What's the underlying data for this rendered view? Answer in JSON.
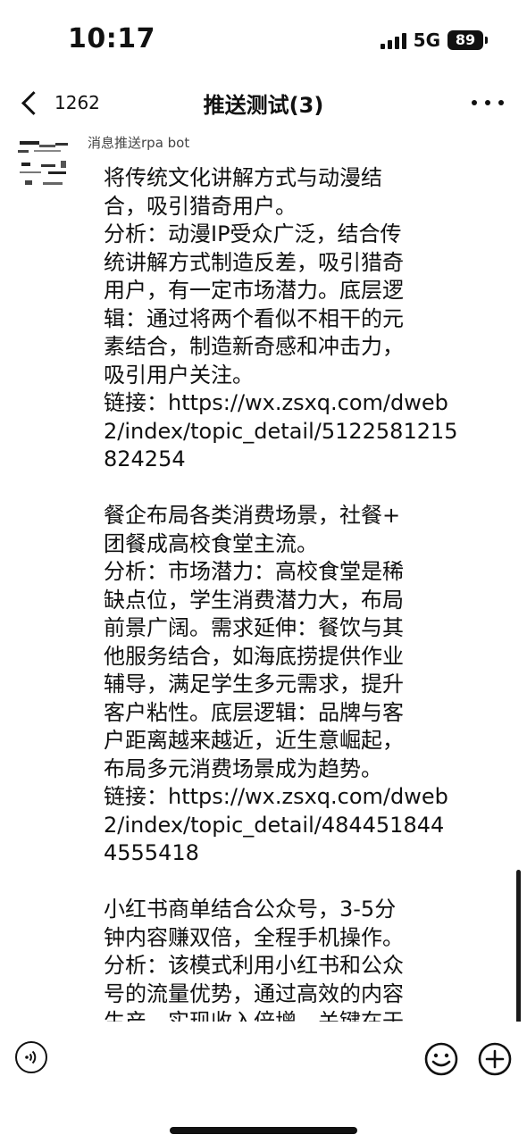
{
  "status_bar": {
    "time": "10:17",
    "network": "5G",
    "battery": "89"
  },
  "nav": {
    "back_count": "1262",
    "title": "推送测试(3)",
    "more_icon": "more-horizontal-icon"
  },
  "chat": {
    "sender_name": "消息推送rpa bot",
    "message_lines": [
      "将传统文化讲解方式与动漫结",
      "合，吸引猎奇用户。",
      "分析：动漫IP受众广泛，结合传",
      "统讲解方式制造反差，吸引猎奇",
      "用户，有一定市场潜力。底层逻",
      "辑：通过将两个看似不相干的元",
      "素结合，制造新奇感和冲击力，",
      "吸引用户关注。",
      "链接：https://wx.zsxq.com/dweb",
      "2/index/topic_detail/5122581215",
      "824254",
      "",
      "餐企布局各类消费场景，社餐+",
      "团餐成高校食堂主流。",
      "分析：市场潜力：高校食堂是稀",
      "缺点位，学生消费潜力大，布局",
      "前景广阔。需求延伸：餐饮与其",
      "他服务结合，如海底捞提供作业",
      "辅导，满足学生多元需求，提升",
      "客户粘性。底层逻辑：品牌与客",
      "户距离越来越近，近生意崛起，",
      "布局多元消费场景成为趋势。",
      "链接：https://wx.zsxq.com/dweb",
      "2/index/topic_detail/484451844",
      "4555418",
      "",
      "小红书商单结合公众号，3-5分",
      "钟内容赚双倍，全程手机操作。",
      "分析：该模式利用小红书和公众",
      "号的流量优势，通过高效的内容",
      "生产，实现收入倍增，关键在于"
    ]
  },
  "input_bar": {
    "voice_icon": "voice-icon",
    "emoji_icon": "emoji-icon",
    "add_icon": "plus-circle-icon",
    "input_value": ""
  }
}
